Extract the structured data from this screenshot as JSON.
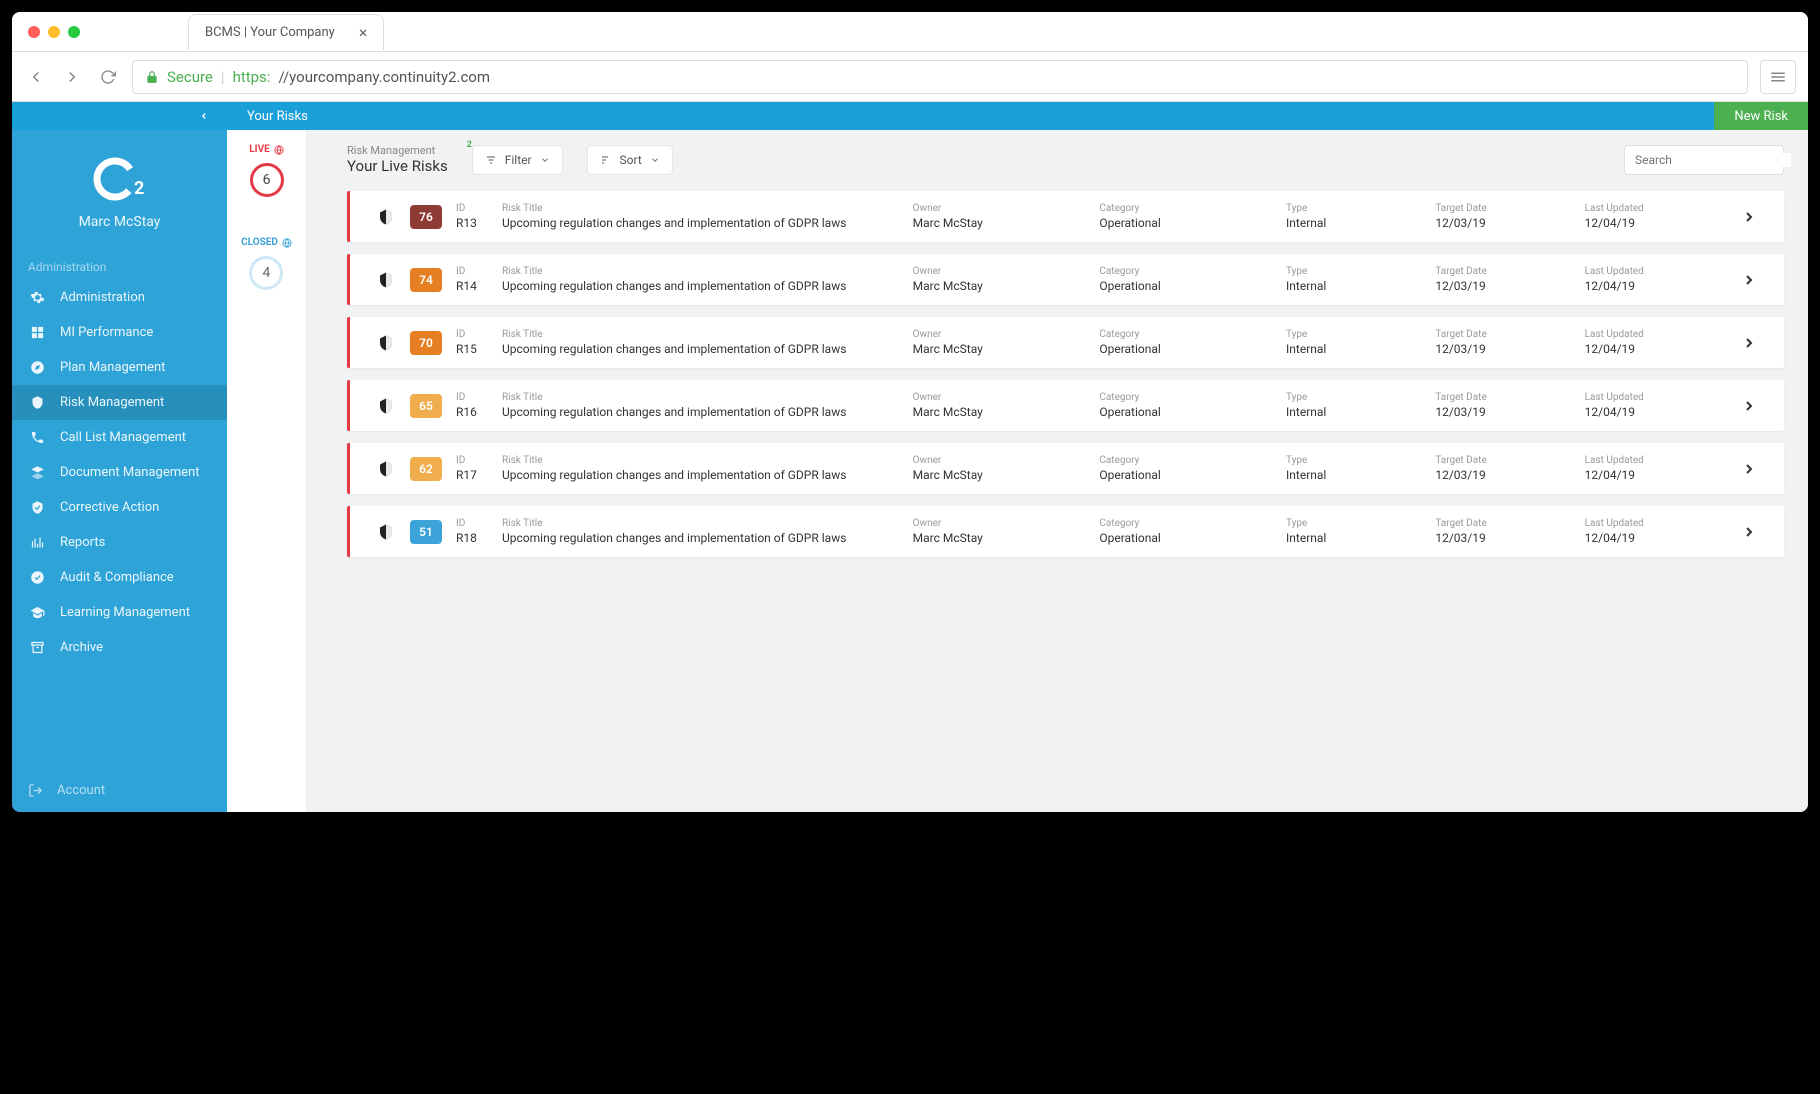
{
  "browser": {
    "tab_title": "BCMS | Your Company",
    "secure_label": "Secure",
    "url_proto": "https:",
    "url_rest": "//yourcompany.continuity2.com"
  },
  "topbar": {
    "crumb": "Your Risks",
    "new_risk": "New Risk"
  },
  "sidebar": {
    "brand": "C",
    "brand_sub": "2",
    "user": "Marc McStay",
    "section": "Administration",
    "items": [
      {
        "label": "Administration",
        "icon": "gear"
      },
      {
        "label": "MI Performance",
        "icon": "dashboard"
      },
      {
        "label": "Plan Management",
        "icon": "compass"
      },
      {
        "label": "Risk Management",
        "icon": "shield",
        "active": true
      },
      {
        "label": "Call List Management",
        "icon": "phone"
      },
      {
        "label": "Document Management",
        "icon": "layers"
      },
      {
        "label": "Corrective Action",
        "icon": "shield-check"
      },
      {
        "label": "Reports",
        "icon": "bars"
      },
      {
        "label": "Audit & Compliance",
        "icon": "check-circle"
      },
      {
        "label": "Learning Management",
        "icon": "grad"
      },
      {
        "label": "Archive",
        "icon": "archive"
      }
    ],
    "account": "Account"
  },
  "status": {
    "live_label": "LIVE",
    "live_count": "6",
    "closed_label": "CLOSED",
    "closed_count": "4"
  },
  "toolbar": {
    "sup": "Risk Management",
    "sub": "Your Live Risks",
    "filter": "Filter",
    "filter_badge": "2",
    "sort": "Sort",
    "search_placeholder": "Search"
  },
  "columns": {
    "id": "ID",
    "title": "Risk Title",
    "owner": "Owner",
    "category": "Category",
    "type": "Type",
    "target": "Target Date",
    "updated": "Last Updated"
  },
  "risks": [
    {
      "score": "76",
      "color": "#8e3b36",
      "id": "R13",
      "title": "Upcoming regulation changes and implementation of GDPR laws",
      "owner": "Marc McStay",
      "category": "Operational",
      "type": "Internal",
      "target": "12/03/19",
      "updated": "12/04/19"
    },
    {
      "score": "74",
      "color": "#e67e22",
      "id": "R14",
      "title": "Upcoming regulation changes and implementation of GDPR laws",
      "owner": "Marc McStay",
      "category": "Operational",
      "type": "Internal",
      "target": "12/03/19",
      "updated": "12/04/19"
    },
    {
      "score": "70",
      "color": "#e67e22",
      "id": "R15",
      "title": "Upcoming regulation changes and implementation of GDPR laws",
      "owner": "Marc McStay",
      "category": "Operational",
      "type": "Internal",
      "target": "12/03/19",
      "updated": "12/04/19"
    },
    {
      "score": "65",
      "color": "#f0ad4e",
      "id": "R16",
      "title": "Upcoming regulation changes and implementation of GDPR laws",
      "owner": "Marc McStay",
      "category": "Operational",
      "type": "Internal",
      "target": "12/03/19",
      "updated": "12/04/19"
    },
    {
      "score": "62",
      "color": "#f0ad4e",
      "id": "R17",
      "title": "Upcoming regulation changes and implementation of GDPR laws",
      "owner": "Marc McStay",
      "category": "Operational",
      "type": "Internal",
      "target": "12/03/19",
      "updated": "12/04/19"
    },
    {
      "score": "51",
      "color": "#3ba3d8",
      "id": "R18",
      "title": "Upcoming regulation changes and implementation of GDPR laws",
      "owner": "Marc McStay",
      "category": "Operational",
      "type": "Internal",
      "target": "12/03/19",
      "updated": "12/04/19"
    }
  ]
}
